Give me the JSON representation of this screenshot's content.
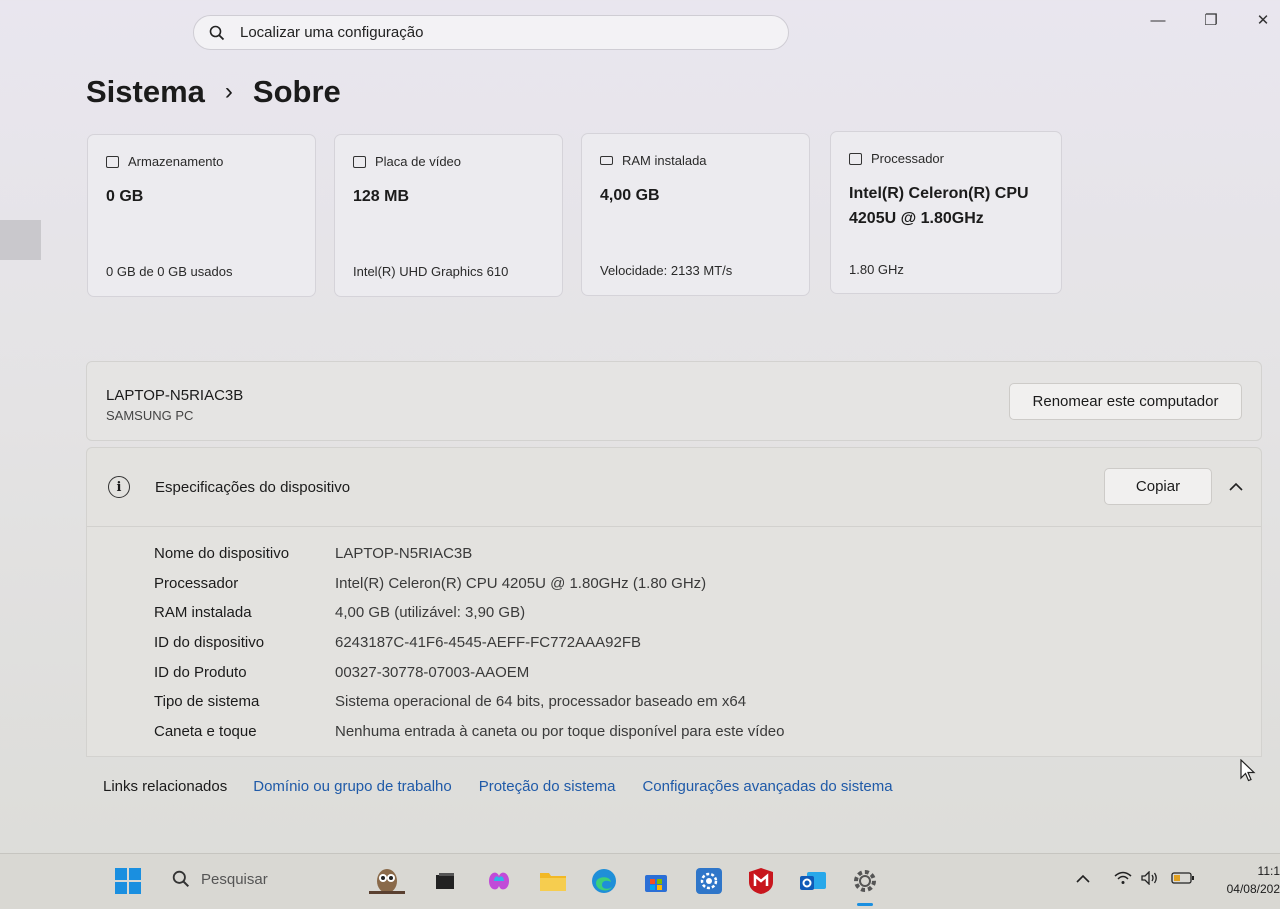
{
  "search": {
    "placeholder": "Localizar uma configuração"
  },
  "window_controls": {
    "minimize": "—",
    "maximize": "❐",
    "close": "✕"
  },
  "breadcrumb": {
    "parent": "Sistema",
    "separator": "›",
    "current": "Sobre"
  },
  "cards": [
    {
      "label": "Armazenamento",
      "value": "0 GB",
      "footer": "0 GB de 0 GB usados",
      "icon": "storage-icon"
    },
    {
      "label": "Placa de vídeo",
      "value": "128 MB",
      "footer": "Intel(R) UHD Graphics 610",
      "icon": "display-icon"
    },
    {
      "label": "RAM instalada",
      "value": "4,00 GB",
      "footer": "Velocidade: 2133 MT/s",
      "icon": "ram-icon"
    },
    {
      "label": "Processador",
      "value": "Intel(R) Celeron(R) CPU 4205U @ 1.80GHz",
      "footer": "1.80 GHz",
      "icon": "processor-icon"
    }
  ],
  "device": {
    "name": "LAPTOP-N5RIAC3B",
    "model": "SAMSUNG PC",
    "rename_label": "Renomear este computador"
  },
  "specs": {
    "title": "Especificações do dispositivo",
    "copy_label": "Copiar",
    "rows": [
      {
        "key": "Nome do dispositivo",
        "value": "LAPTOP-N5RIAC3B"
      },
      {
        "key": "Processador",
        "value": "Intel(R) Celeron(R) CPU 4205U @ 1.80GHz (1.80 GHz)"
      },
      {
        "key": "RAM instalada",
        "value": "4,00 GB (utilizável: 3,90 GB)"
      },
      {
        "key": "ID do dispositivo",
        "value": "6243187C-41F6-4545-AEFF-FC772AAA92FB"
      },
      {
        "key": "ID do Produto",
        "value": "00327-30778-07003-AAOEM"
      },
      {
        "key": "Tipo de sistema",
        "value": "Sistema operacional de 64 bits, processador baseado em x64"
      },
      {
        "key": "Caneta e toque",
        "value": "Nenhuma entrada à caneta ou por toque disponível para este vídeo"
      }
    ]
  },
  "related_links": {
    "label": "Links relacionados",
    "links": [
      "Domínio ou grupo de trabalho",
      "Proteção do sistema",
      "Configurações avançadas do sistema"
    ]
  },
  "taskbar": {
    "search_placeholder": "Pesquisar",
    "time": "11:1",
    "date": "04/08/202"
  },
  "colors": {
    "link": "#1f5aa8",
    "windows_blue": "#1a8fe0"
  }
}
